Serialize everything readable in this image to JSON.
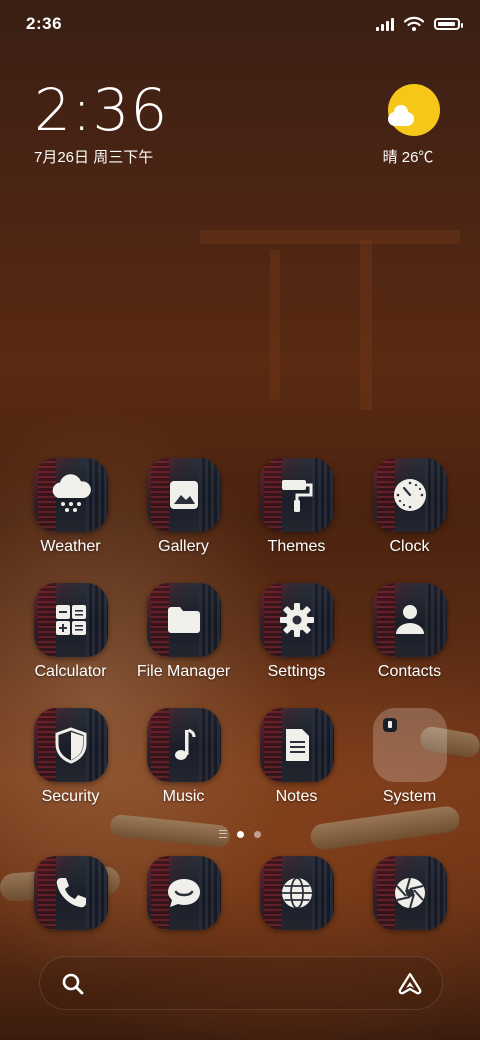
{
  "status_bar": {
    "time": "2:36",
    "icons": [
      "signal-icon",
      "wifi-icon",
      "battery-icon"
    ],
    "battery_level": 0.95
  },
  "clock_widget": {
    "time": "2:36",
    "date": "7月26日 周三下午"
  },
  "weather_widget": {
    "icon": "sunny-cloud-icon",
    "text": "晴 26℃"
  },
  "apps": [
    {
      "label": "Weather",
      "icon": "weather-icon"
    },
    {
      "label": "Gallery",
      "icon": "gallery-icon"
    },
    {
      "label": "Themes",
      "icon": "paint-roller-icon"
    },
    {
      "label": "Clock",
      "icon": "clock-icon"
    },
    {
      "label": "Calculator",
      "icon": "calculator-icon"
    },
    {
      "label": "File Manager",
      "icon": "folder-icon"
    },
    {
      "label": "Settings",
      "icon": "gear-icon"
    },
    {
      "label": "Contacts",
      "icon": "person-icon"
    },
    {
      "label": "Security",
      "icon": "shield-icon"
    },
    {
      "label": "Music",
      "icon": "music-note-icon"
    },
    {
      "label": "Notes",
      "icon": "document-icon"
    },
    {
      "label": "System",
      "icon": "folder-group-icon"
    }
  ],
  "page_indicator": {
    "pages": 2,
    "active": 0
  },
  "dock": [
    {
      "icon": "phone-icon"
    },
    {
      "icon": "message-icon"
    },
    {
      "icon": "browser-icon"
    },
    {
      "icon": "camera-icon"
    }
  ],
  "search_bar": {
    "left_icon": "search-icon",
    "right_icon": "assistant-icon"
  },
  "colors": {
    "sun": "#f6c718",
    "label_text": "#ffffff"
  }
}
